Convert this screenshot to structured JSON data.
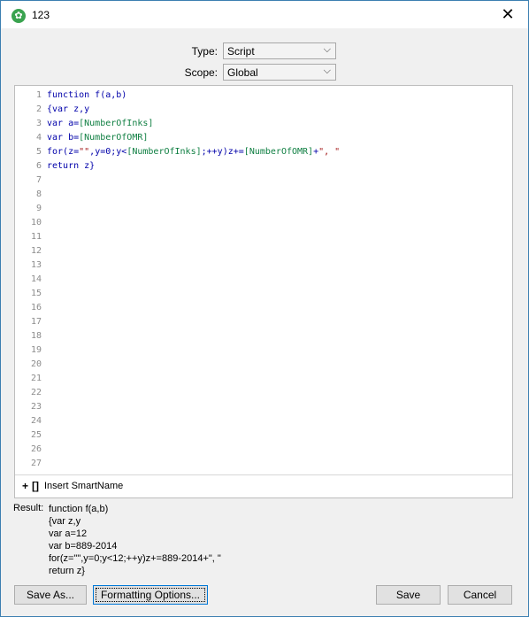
{
  "window": {
    "title": "123",
    "close_glyph": "✕",
    "app_icon": "gear-icon"
  },
  "type_field": {
    "label": "Type:",
    "value": "Script",
    "chevron": "⌵"
  },
  "scope_field": {
    "label": "Scope:",
    "value": "Global",
    "chevron": "⌵"
  },
  "editor": {
    "line_numbers": [
      "1",
      "2",
      "3",
      "4",
      "5",
      "6",
      "7",
      "8",
      "9",
      "10",
      "11",
      "12",
      "13",
      "14",
      "15",
      "16",
      "17",
      "18",
      "19",
      "20",
      "21",
      "22",
      "23",
      "24",
      "25",
      "26",
      "27"
    ],
    "lines": [
      {
        "parts": [
          {
            "t": "function f(a,b)",
            "c": "kw"
          }
        ]
      },
      {
        "parts": [
          {
            "t": "{var z,y",
            "c": "kw"
          }
        ]
      },
      {
        "parts": [
          {
            "t": "var a=",
            "c": "kw"
          },
          {
            "t": "[NumberOfInks]",
            "c": "ref"
          }
        ]
      },
      {
        "parts": [
          {
            "t": "var b=",
            "c": "kw"
          },
          {
            "t": "[NumberOfOMR]",
            "c": "ref"
          }
        ]
      },
      {
        "parts": [
          {
            "t": "for(z=",
            "c": "kw"
          },
          {
            "t": "\"\"",
            "c": "str"
          },
          {
            "t": ",y=0;y<",
            "c": "kw"
          },
          {
            "t": "[NumberOfInks]",
            "c": "ref"
          },
          {
            "t": ";++y)z+=",
            "c": "kw"
          },
          {
            "t": "[NumberOfOMR]",
            "c": "ref"
          },
          {
            "t": "+",
            "c": "kw"
          },
          {
            "t": "\", \"",
            "c": "str"
          }
        ]
      },
      {
        "parts": [
          {
            "t": "return z}",
            "c": "kw"
          }
        ]
      }
    ],
    "colors": {
      "keyword": "#0000aa",
      "reference": "#0f7f42",
      "string": "#a31515"
    }
  },
  "insert_smartname": {
    "plus": "+",
    "brackets": "[]",
    "label": "Insert SmartName"
  },
  "result": {
    "label": "Result:",
    "lines": [
      "function f(a,b)",
      "{var z,y",
      "var a=12",
      "var b=889-2014",
      "for(z=\"\",y=0;y<12;++y)z+=889-2014+\", \"",
      "return z}"
    ]
  },
  "buttons": {
    "save_as": "Save As...",
    "formatting_options": "Formatting Options...",
    "save": "Save",
    "cancel": "Cancel"
  }
}
